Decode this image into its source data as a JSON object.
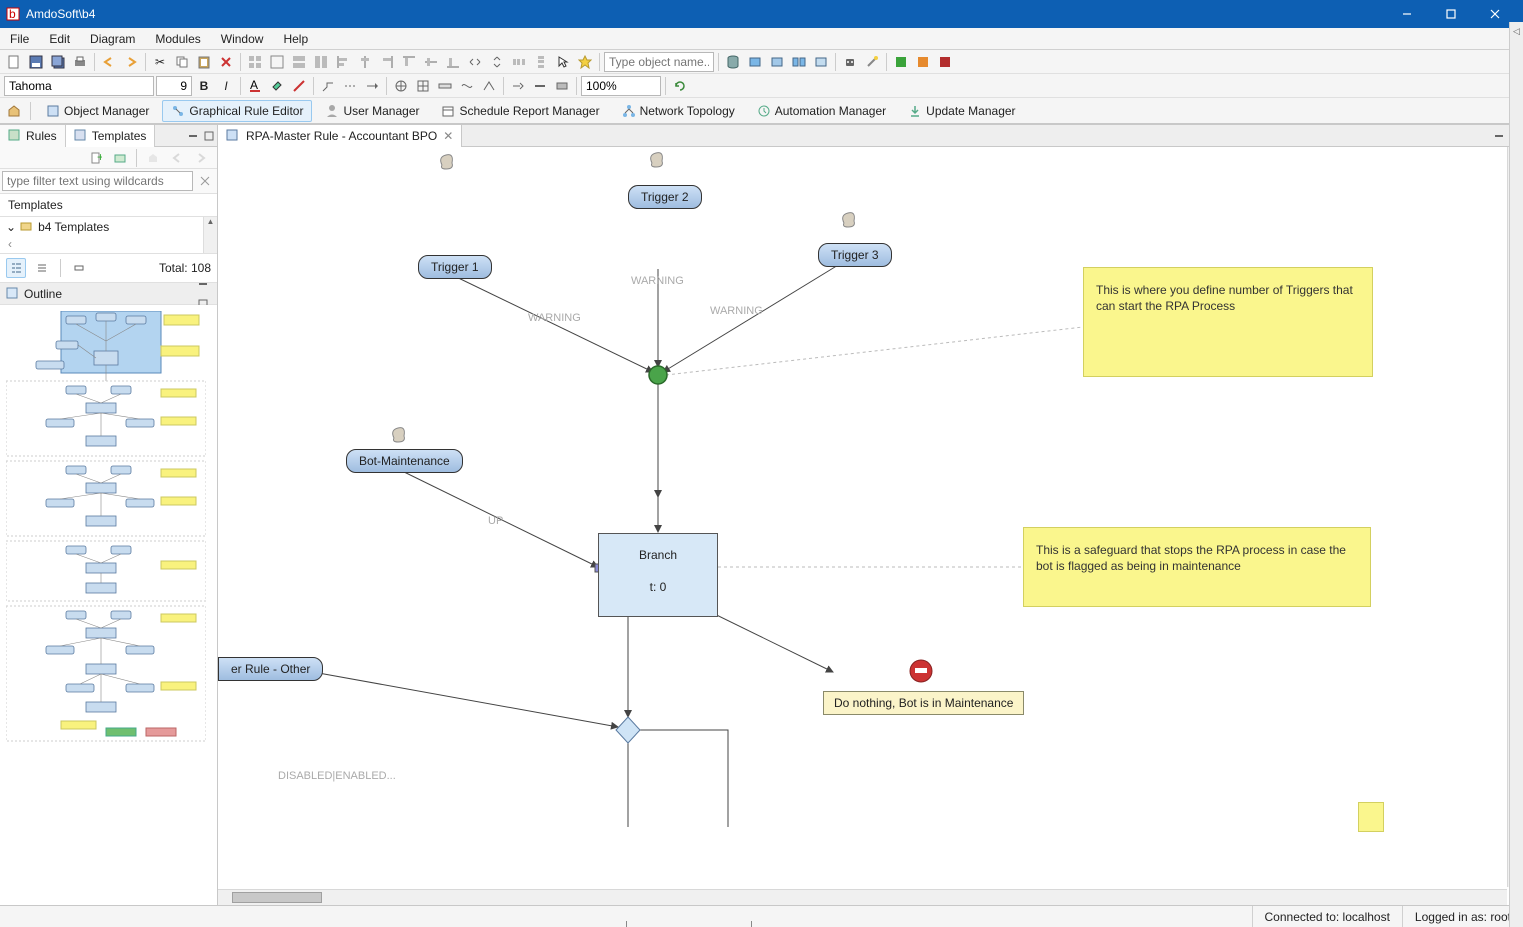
{
  "window": {
    "title": "AmdoSoft\\b4"
  },
  "menu": [
    "File",
    "Edit",
    "Diagram",
    "Modules",
    "Window",
    "Help"
  ],
  "toolbar1": {
    "object_name_placeholder": "Type object name...",
    "font_name": "Tahoma",
    "font_size": "9",
    "zoom": "100%"
  },
  "crumbs": [
    {
      "label": "Object Manager",
      "active": false
    },
    {
      "label": "Graphical Rule Editor",
      "active": true
    },
    {
      "label": "User Manager",
      "active": false
    },
    {
      "label": "Schedule Report Manager",
      "active": false
    },
    {
      "label": "Network Topology",
      "active": false
    },
    {
      "label": "Automation Manager",
      "active": false
    },
    {
      "label": "Update Manager",
      "active": false
    }
  ],
  "leftpane": {
    "tabs": [
      "Rules",
      "Templates"
    ],
    "active_tab": 1,
    "filter_placeholder": "type filter text using wildcards",
    "section_title": "Templates",
    "tree_root": "b4 Templates",
    "total_label": "Total: 108"
  },
  "outline": {
    "title": "Outline"
  },
  "editor": {
    "tab_title": "RPA-Master Rule - Accountant BPO",
    "nodes": {
      "trigger1": "Trigger 1",
      "trigger2": "Trigger 2",
      "trigger3": "Trigger 3",
      "bot_maint": "Bot-Maintenance",
      "branch_title": "Branch",
      "branch_t": "t: 0",
      "msg_bot_maint": "Do nothing, Bot is in Maintenance",
      "rule_other": "er Rule - Other"
    },
    "edge_labels": {
      "warn1": "WARNING",
      "warn2": "WARNING",
      "warn3": "WARNING",
      "up": "UP",
      "disabled": "DISABLED|ENABLED..."
    },
    "sticky1": "This is where you define number of Triggers that can start the RPA Process",
    "sticky2": "This is a safeguard that stops the RPA process in case the bot is flagged as being in maintenance"
  },
  "status": {
    "connected": "Connected to: localhost",
    "logged_in": "Logged in as: root"
  }
}
